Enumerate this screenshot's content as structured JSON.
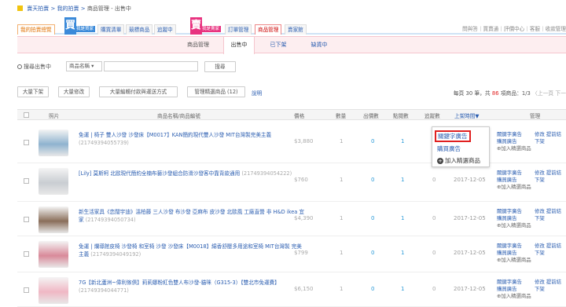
{
  "breadcrumb": {
    "home": "賣天拍賣",
    "auction": "我的拍賣",
    "current": "商品管理 - 出售中",
    "sep": " > "
  },
  "nav": {
    "tabs": [
      "我的拍賣總覽",
      "購買清單",
      "競標商品",
      "追蹤中",
      "訂單管理",
      "商品管理",
      "賣家館"
    ],
    "badge_buy": "買",
    "badge_buy_sub": "我是買家",
    "badge_sell": "賣",
    "badge_sell_sub": "我是賣家",
    "toplinks": "問與答｜買賣通｜評價中心｜客服｜收款管理"
  },
  "subtabs": [
    "商品管理",
    "出售中",
    "已下架",
    "缺貨中"
  ],
  "search": {
    "label": "搜尋出售中",
    "select": "商品名稱",
    "button": "搜尋"
  },
  "actions": {
    "buttons": [
      "大量下架",
      "大量修改",
      "大量編輯付款與運送方式",
      "管理精選商品 (12)"
    ],
    "help": "說明",
    "pager": {
      "prefix": "每頁 30 筆，共",
      "total": "86",
      "suffix": "項商品：1/3",
      "prev": "〈上一頁",
      "next": "下一"
    }
  },
  "table": {
    "headers": [
      "照片",
      "商品名稱/商品編號",
      "價格",
      "數量",
      "出價數",
      "點閱數",
      "追蹤數",
      "上架時間▼",
      "管理"
    ],
    "rows": [
      {
        "title": "免運 | 椅子 雙人沙發 沙發床【M0017】KAN簡約現代雙人沙發 MIT台灣製完美主義",
        "pid": "(21749394055739)",
        "price": "$3,880",
        "qty": "1",
        "bids": "0",
        "views": "1",
        "follows": "0",
        "date": "2017-12-05"
      },
      {
        "title": "[Lily] 莫斯柯 北歐現代簡約全楠布藝沙發組合防滑沙發客中靠背款通用",
        "pid": "(21749394054222)",
        "price": "$760",
        "qty": "1",
        "bids": "0",
        "views": "1",
        "follows": "0",
        "date": "2017-12-05"
      },
      {
        "title": "新生活家具《恋闊宇迪》溫柏藤 三人沙發 布沙發 亞麻布 皮沙發 北歐風 工廠直營 非 H&D ikea 宜家",
        "pid": "(21749394050734)",
        "price": "$4,390",
        "qty": "1",
        "bids": "0",
        "views": "1",
        "follows": "0",
        "date": "2017-12-05"
      },
      {
        "title": "免運 | 爛導館皮椅 沙發椅 和室椅 沙發 沙發床【M0018】綿香舒壓多用途和室椅 MIT台灣製 完美主義",
        "pid": "(21749394049192)",
        "price": "$799",
        "qty": "1",
        "bids": "0",
        "views": "1",
        "follows": "0",
        "date": "2017-12-05"
      },
      {
        "title": "7G【新北蘆洲~偉利傢俱】莉莉娜粉紅色雙人布沙發-貓咪（G315-3）【雙北市免運費】",
        "pid": "(21749394044771)",
        "price": "$6,150",
        "qty": "1",
        "bids": "0",
        "views": "1",
        "follows": "0",
        "date": "2017-12-05"
      }
    ],
    "manage": {
      "keyword_ad": "關鍵字廣告",
      "buy_ad": "購買廣告",
      "add_featured": "加入精選商品",
      "edit": "修改",
      "relist": "提前結",
      "delist": "下架"
    }
  },
  "popup": {
    "keyword_ad": "關鍵字廣告",
    "buy_ad": "購買廣告",
    "add_featured": "加入精選商品"
  },
  "colors": {
    "accent_blue": "#2a5db0",
    "pink_bg": "#fdeef0",
    "red": "#e02020",
    "buy_badge": "#3b8ad9",
    "sell_badge": "#e8327f"
  },
  "thumb_colors": [
    "#8fb3cf",
    "#c9cdd2",
    "#8a6e5a",
    "#d98a9a",
    "#f0b7c4"
  ]
}
